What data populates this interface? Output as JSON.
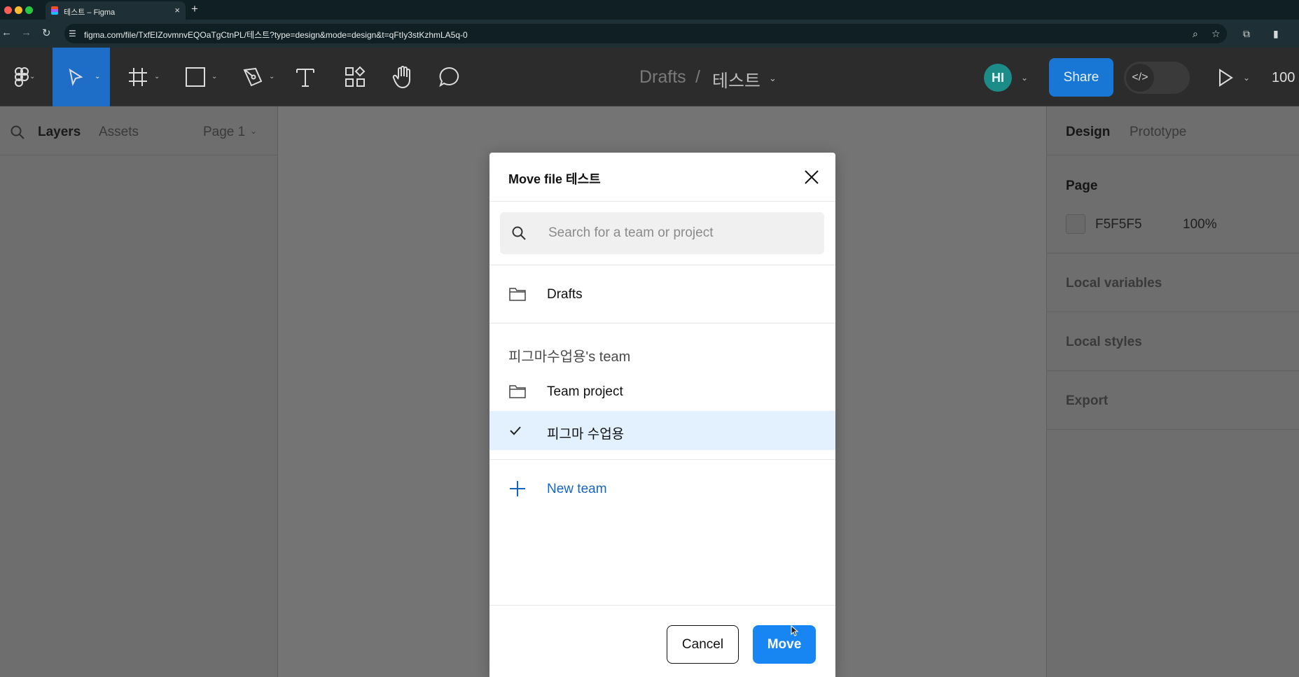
{
  "browser": {
    "tab_title": "테스트 – Figma",
    "tab_close": "×",
    "new_tab": "+",
    "url": "figma.com/file/TxfEIZovmnvEQOaTgCtnPL/테스트?type=design&mode=design&t=qFtIy3stKzhmLA5q-0",
    "traffic_colors": [
      "#ff5f57",
      "#febc2e",
      "#28c840"
    ]
  },
  "toolbar": {
    "breadcrumb_project": "Drafts",
    "breadcrumb_separator": "/",
    "file_name": "테스트",
    "avatar_initials": "HI",
    "share_label": "Share",
    "dev_mode_label": "</>",
    "zoom": "100"
  },
  "left_panel": {
    "tab_layers": "Layers",
    "tab_assets": "Assets",
    "page_selector": "Page 1"
  },
  "right_panel": {
    "tab_design": "Design",
    "tab_prototype": "Prototype",
    "page_label": "Page",
    "page_color": "F5F5F5",
    "page_opacity": "100%",
    "local_variables": "Local variables",
    "local_styles": "Local styles",
    "export": "Export"
  },
  "modal": {
    "title": "Move file 테스트",
    "search_placeholder": "Search for a team or project",
    "drafts": "Drafts",
    "team_section": "피그마수업용's team",
    "team_project": "Team project",
    "selected_team": "피그마 수업용",
    "new_team": "New team",
    "cancel": "Cancel",
    "move": "Move"
  }
}
